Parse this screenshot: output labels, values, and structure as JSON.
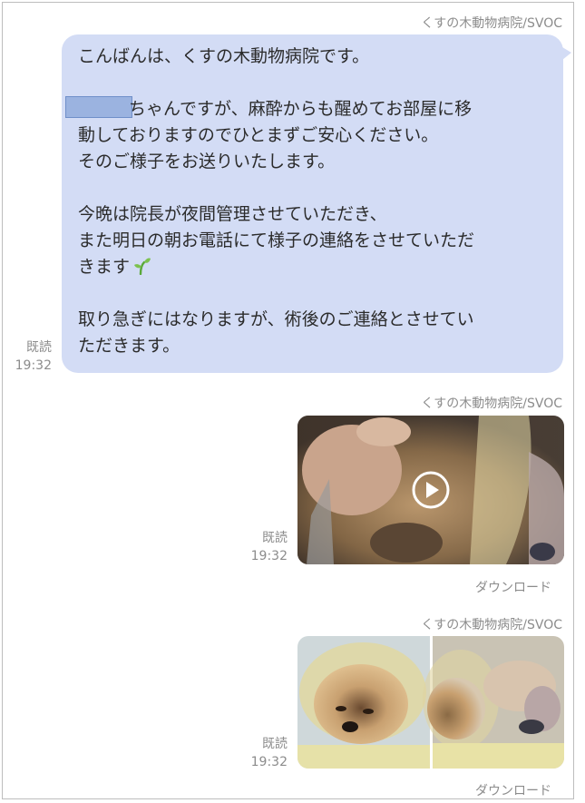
{
  "messages": [
    {
      "sender": "くすの木動物病院/SVOC",
      "lines": [
        "こんばんは、くすの木動物病院です。",
        "",
        "ちゃんですが、麻酔からも醒めてお部屋に移",
        "動しておりますのでひとまずご安心ください。",
        "そのご様子をお送りいたします。",
        "",
        "今晩は院長が夜間管理させていただき、",
        "また明日の朝お電話にて様子の連絡をさせていただ",
        "きます",
        "",
        "取り急ぎにはなりますが、術後のご連絡とさせてい",
        "ただきます。"
      ],
      "read_label": "既読",
      "time": "19:32"
    },
    {
      "sender": "くすの木動物病院/SVOC",
      "type": "video",
      "read_label": "既読",
      "time": "19:32",
      "download_label": "ダウンロード",
      "icon": "play-icon"
    },
    {
      "sender": "くすの木動物病院/SVOC",
      "type": "photos",
      "read_label": "既読",
      "time": "19:32",
      "download_label": "ダウンロード"
    }
  ],
  "colors": {
    "bubble": "#d3dcf5",
    "redaction": "#9bb3e0",
    "meta_text": "#8c8c8c"
  }
}
